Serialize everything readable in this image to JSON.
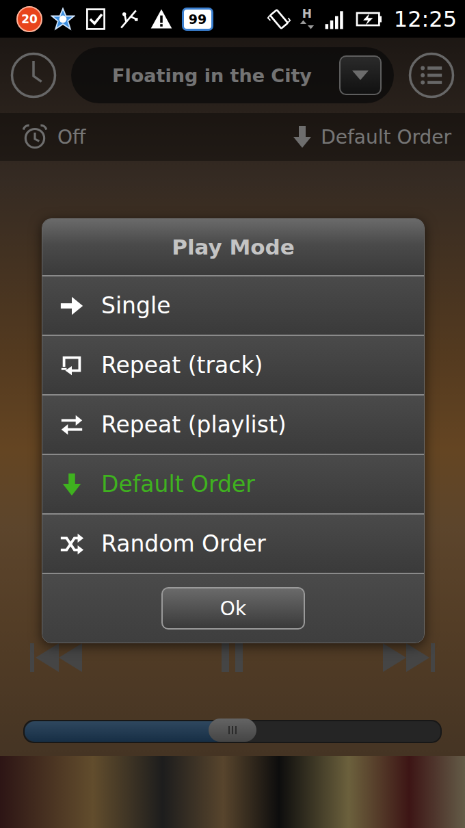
{
  "status_bar": {
    "notification_count": "20",
    "badge": "99",
    "network": "H",
    "time": "12:25"
  },
  "player": {
    "title": "Floating in the City",
    "alarm": "Off",
    "play_order": "Default Order",
    "playing": true,
    "seek": {
      "level": 0.5
    }
  },
  "dialog": {
    "title": "Play Mode",
    "options": [
      {
        "label": "Single",
        "selected": false
      },
      {
        "label": "Repeat (track)",
        "selected": false
      },
      {
        "label": "Repeat (playlist)",
        "selected": false
      },
      {
        "label": "Default Order",
        "selected": true
      },
      {
        "label": "Random Order",
        "selected": false
      }
    ],
    "buttons": [
      "Ok"
    ]
  }
}
